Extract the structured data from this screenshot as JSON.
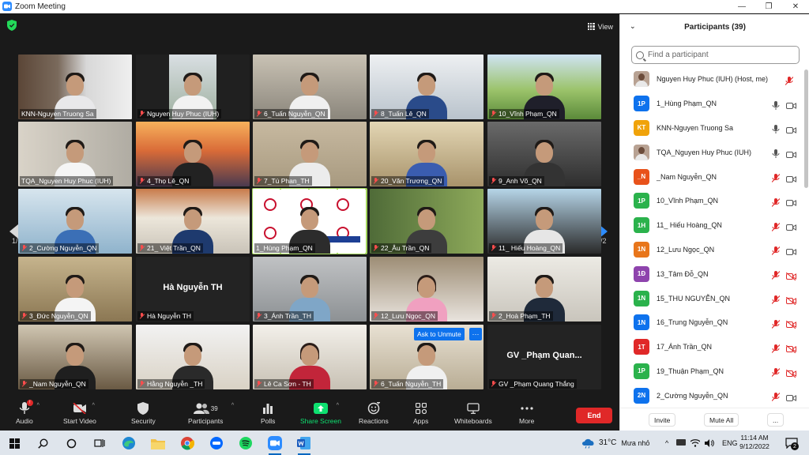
{
  "window": {
    "title": "Zoom Meeting",
    "minimize": "—",
    "maximize": "❐",
    "close": "✕"
  },
  "meeting": {
    "view_label": "View",
    "page_left": "1/2",
    "page_right": "1/2",
    "tiles": [
      {
        "name": "KNN-Nguyen Truong Sa",
        "muted": false
      },
      {
        "name": "Nguyen Huy Phuc (IUH)",
        "muted": true
      },
      {
        "name": "6_Tuấn Nguyễn_QN",
        "muted": true
      },
      {
        "name": "8_Tuấn Lê_QN",
        "muted": true
      },
      {
        "name": "10_Vĩnh Phạm_QN",
        "muted": true
      },
      {
        "name": "TQA_Nguyen Huy Phuc (IUH)",
        "muted": false
      },
      {
        "name": "4_Thọ Lê_QN",
        "muted": true
      },
      {
        "name": "7_Tú Phan_TH",
        "muted": true
      },
      {
        "name": "20_Văn Trương_QN",
        "muted": true
      },
      {
        "name": "9_Anh Võ_QN",
        "muted": true
      },
      {
        "name": "2_Cường Nguyễn_QN",
        "muted": true
      },
      {
        "name": "21_ Việt Trần_QN",
        "muted": true
      },
      {
        "name": "1_Hùng Phạm_QN",
        "muted": false
      },
      {
        "name": "22_Âu Trần_QN",
        "muted": true
      },
      {
        "name": "11_ Hiếu Hoàng_QN",
        "muted": true
      },
      {
        "name": "3_Đức Nguyễn_QN",
        "muted": true
      },
      {
        "name": "Hà Nguyễn TH",
        "muted": true,
        "big": "Hà Nguyễn TH"
      },
      {
        "name": "3_Ánh Trần_TH",
        "muted": true
      },
      {
        "name": "12_Lưu Ngọc_QN",
        "muted": true
      },
      {
        "name": "2_Hoà Phạm_TH",
        "muted": true
      },
      {
        "name": "_Nam Nguyễn_QN",
        "muted": true
      },
      {
        "name": "Hằng Nguyễn _TH",
        "muted": true
      },
      {
        "name": "Lê Ca Sơn - TH",
        "muted": true
      },
      {
        "name": "6_Tuấn Nguyễn_TH",
        "muted": true
      },
      {
        "name": "GV _Phạm Quang Thắng",
        "muted": true,
        "big": "GV _Phạm Quan..."
      }
    ],
    "ask_unmute": "Ask to Unmute",
    "ask_more": "···"
  },
  "toolbar": {
    "audio": "Audio",
    "audio_badge": "!",
    "start_video": "Start Video",
    "security": "Security",
    "participants": "Participants",
    "participants_count": "39",
    "polls": "Polls",
    "share_screen": "Share Screen",
    "reactions": "Reactions",
    "apps": "Apps",
    "whiteboards": "Whiteboards",
    "more": "More",
    "end": "End"
  },
  "panel": {
    "title": "Participants (39)",
    "search_placeholder": "Find a participant",
    "participants": [
      {
        "avatar": "",
        "photo": true,
        "name": "Nguyen Huy Phuc (IUH) (Host, me)",
        "mic": "muted",
        "cam": "none",
        "color": "#b8a293"
      },
      {
        "avatar": "1P",
        "photo": false,
        "name": "1_Hùng Phạm_QN",
        "mic": "on",
        "cam": "on",
        "color": "#0e72ed"
      },
      {
        "avatar": "KT",
        "photo": false,
        "name": "KNN-Nguyen Truong Sa",
        "mic": "on",
        "cam": "on",
        "color": "#f0a30a"
      },
      {
        "avatar": "",
        "photo": true,
        "name": "TQA_Nguyen Huy Phuc (IUH)",
        "mic": "on",
        "cam": "on",
        "color": "#b8a293"
      },
      {
        "avatar": "_N",
        "photo": false,
        "name": "_Nam Nguyễn_QN",
        "mic": "muted",
        "cam": "on",
        "color": "#e8521b"
      },
      {
        "avatar": "1P",
        "photo": false,
        "name": "10_Vĩnh Phạm_QN",
        "mic": "muted",
        "cam": "on",
        "color": "#2bb24c"
      },
      {
        "avatar": "1H",
        "photo": false,
        "name": "11_ Hiếu Hoàng_QN",
        "mic": "muted",
        "cam": "on",
        "color": "#2bb24c"
      },
      {
        "avatar": "1N",
        "photo": false,
        "name": "12_Lưu Ngọc_QN",
        "mic": "muted",
        "cam": "on",
        "color": "#e8761b"
      },
      {
        "avatar": "1Đ",
        "photo": false,
        "name": "13_Tâm Đỗ_QN",
        "mic": "muted",
        "cam": "off",
        "color": "#8e44ad"
      },
      {
        "avatar": "1N",
        "photo": false,
        "name": "15_THU NGUYỄN_QN",
        "mic": "muted",
        "cam": "off",
        "color": "#2bb24c"
      },
      {
        "avatar": "1N",
        "photo": false,
        "name": "16_Trung Nguyễn_QN",
        "mic": "muted",
        "cam": "off",
        "color": "#0e72ed"
      },
      {
        "avatar": "1T",
        "photo": false,
        "name": "17_Ánh Trần_QN",
        "mic": "muted",
        "cam": "off",
        "color": "#e02828"
      },
      {
        "avatar": "1P",
        "photo": false,
        "name": "19_Thuận Phạm_QN",
        "mic": "muted",
        "cam": "off",
        "color": "#2bb24c"
      },
      {
        "avatar": "2N",
        "photo": false,
        "name": "2_Cường Nguyễn_QN",
        "mic": "muted",
        "cam": "on",
        "color": "#0e72ed"
      }
    ],
    "invite": "Invite",
    "mute_all": "Mute All",
    "more": "..."
  },
  "taskbar": {
    "weather": "31°C",
    "weather_text": "Mưa nhỏ",
    "lang": "ENG",
    "time": "11:14 AM",
    "date": "9/12/2022",
    "notif_count": "2",
    "tray_up": "^"
  },
  "colors": {
    "accent": "#0e72ed",
    "end_red": "#e02828",
    "share_green": "#0ee070",
    "active_outline": "#a4d65e"
  }
}
